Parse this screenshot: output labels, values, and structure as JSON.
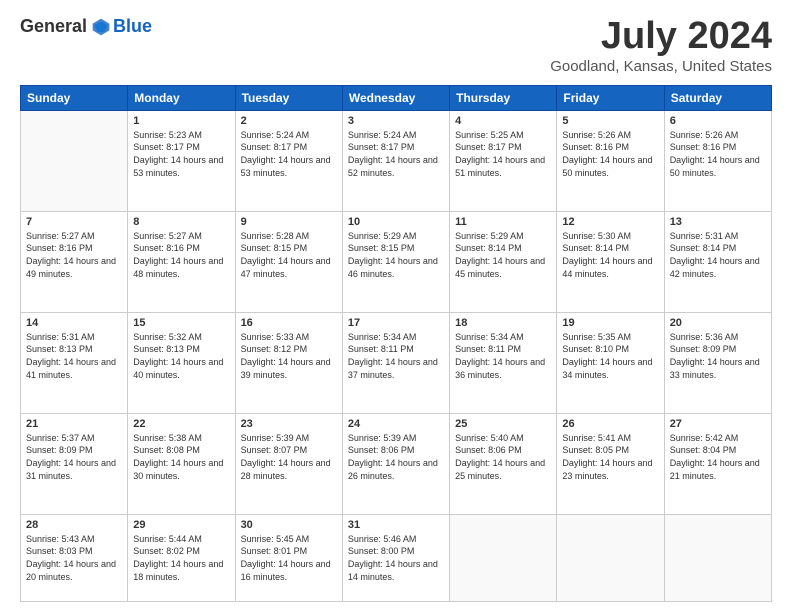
{
  "logo": {
    "general": "General",
    "blue": "Blue"
  },
  "title": "July 2024",
  "subtitle": "Goodland, Kansas, United States",
  "days_header": [
    "Sunday",
    "Monday",
    "Tuesday",
    "Wednesday",
    "Thursday",
    "Friday",
    "Saturday"
  ],
  "weeks": [
    [
      {
        "num": "",
        "sunrise": "",
        "sunset": "",
        "daylight": "",
        "empty": true
      },
      {
        "num": "1",
        "sunrise": "Sunrise: 5:23 AM",
        "sunset": "Sunset: 8:17 PM",
        "daylight": "Daylight: 14 hours and 53 minutes."
      },
      {
        "num": "2",
        "sunrise": "Sunrise: 5:24 AM",
        "sunset": "Sunset: 8:17 PM",
        "daylight": "Daylight: 14 hours and 53 minutes."
      },
      {
        "num": "3",
        "sunrise": "Sunrise: 5:24 AM",
        "sunset": "Sunset: 8:17 PM",
        "daylight": "Daylight: 14 hours and 52 minutes."
      },
      {
        "num": "4",
        "sunrise": "Sunrise: 5:25 AM",
        "sunset": "Sunset: 8:17 PM",
        "daylight": "Daylight: 14 hours and 51 minutes."
      },
      {
        "num": "5",
        "sunrise": "Sunrise: 5:26 AM",
        "sunset": "Sunset: 8:16 PM",
        "daylight": "Daylight: 14 hours and 50 minutes."
      },
      {
        "num": "6",
        "sunrise": "Sunrise: 5:26 AM",
        "sunset": "Sunset: 8:16 PM",
        "daylight": "Daylight: 14 hours and 50 minutes."
      }
    ],
    [
      {
        "num": "7",
        "sunrise": "Sunrise: 5:27 AM",
        "sunset": "Sunset: 8:16 PM",
        "daylight": "Daylight: 14 hours and 49 minutes."
      },
      {
        "num": "8",
        "sunrise": "Sunrise: 5:27 AM",
        "sunset": "Sunset: 8:16 PM",
        "daylight": "Daylight: 14 hours and 48 minutes."
      },
      {
        "num": "9",
        "sunrise": "Sunrise: 5:28 AM",
        "sunset": "Sunset: 8:15 PM",
        "daylight": "Daylight: 14 hours and 47 minutes."
      },
      {
        "num": "10",
        "sunrise": "Sunrise: 5:29 AM",
        "sunset": "Sunset: 8:15 PM",
        "daylight": "Daylight: 14 hours and 46 minutes."
      },
      {
        "num": "11",
        "sunrise": "Sunrise: 5:29 AM",
        "sunset": "Sunset: 8:14 PM",
        "daylight": "Daylight: 14 hours and 45 minutes."
      },
      {
        "num": "12",
        "sunrise": "Sunrise: 5:30 AM",
        "sunset": "Sunset: 8:14 PM",
        "daylight": "Daylight: 14 hours and 44 minutes."
      },
      {
        "num": "13",
        "sunrise": "Sunrise: 5:31 AM",
        "sunset": "Sunset: 8:14 PM",
        "daylight": "Daylight: 14 hours and 42 minutes."
      }
    ],
    [
      {
        "num": "14",
        "sunrise": "Sunrise: 5:31 AM",
        "sunset": "Sunset: 8:13 PM",
        "daylight": "Daylight: 14 hours and 41 minutes."
      },
      {
        "num": "15",
        "sunrise": "Sunrise: 5:32 AM",
        "sunset": "Sunset: 8:13 PM",
        "daylight": "Daylight: 14 hours and 40 minutes."
      },
      {
        "num": "16",
        "sunrise": "Sunrise: 5:33 AM",
        "sunset": "Sunset: 8:12 PM",
        "daylight": "Daylight: 14 hours and 39 minutes."
      },
      {
        "num": "17",
        "sunrise": "Sunrise: 5:34 AM",
        "sunset": "Sunset: 8:11 PM",
        "daylight": "Daylight: 14 hours and 37 minutes."
      },
      {
        "num": "18",
        "sunrise": "Sunrise: 5:34 AM",
        "sunset": "Sunset: 8:11 PM",
        "daylight": "Daylight: 14 hours and 36 minutes."
      },
      {
        "num": "19",
        "sunrise": "Sunrise: 5:35 AM",
        "sunset": "Sunset: 8:10 PM",
        "daylight": "Daylight: 14 hours and 34 minutes."
      },
      {
        "num": "20",
        "sunrise": "Sunrise: 5:36 AM",
        "sunset": "Sunset: 8:09 PM",
        "daylight": "Daylight: 14 hours and 33 minutes."
      }
    ],
    [
      {
        "num": "21",
        "sunrise": "Sunrise: 5:37 AM",
        "sunset": "Sunset: 8:09 PM",
        "daylight": "Daylight: 14 hours and 31 minutes."
      },
      {
        "num": "22",
        "sunrise": "Sunrise: 5:38 AM",
        "sunset": "Sunset: 8:08 PM",
        "daylight": "Daylight: 14 hours and 30 minutes."
      },
      {
        "num": "23",
        "sunrise": "Sunrise: 5:39 AM",
        "sunset": "Sunset: 8:07 PM",
        "daylight": "Daylight: 14 hours and 28 minutes."
      },
      {
        "num": "24",
        "sunrise": "Sunrise: 5:39 AM",
        "sunset": "Sunset: 8:06 PM",
        "daylight": "Daylight: 14 hours and 26 minutes."
      },
      {
        "num": "25",
        "sunrise": "Sunrise: 5:40 AM",
        "sunset": "Sunset: 8:06 PM",
        "daylight": "Daylight: 14 hours and 25 minutes."
      },
      {
        "num": "26",
        "sunrise": "Sunrise: 5:41 AM",
        "sunset": "Sunset: 8:05 PM",
        "daylight": "Daylight: 14 hours and 23 minutes."
      },
      {
        "num": "27",
        "sunrise": "Sunrise: 5:42 AM",
        "sunset": "Sunset: 8:04 PM",
        "daylight": "Daylight: 14 hours and 21 minutes."
      }
    ],
    [
      {
        "num": "28",
        "sunrise": "Sunrise: 5:43 AM",
        "sunset": "Sunset: 8:03 PM",
        "daylight": "Daylight: 14 hours and 20 minutes."
      },
      {
        "num": "29",
        "sunrise": "Sunrise: 5:44 AM",
        "sunset": "Sunset: 8:02 PM",
        "daylight": "Daylight: 14 hours and 18 minutes."
      },
      {
        "num": "30",
        "sunrise": "Sunrise: 5:45 AM",
        "sunset": "Sunset: 8:01 PM",
        "daylight": "Daylight: 14 hours and 16 minutes."
      },
      {
        "num": "31",
        "sunrise": "Sunrise: 5:46 AM",
        "sunset": "Sunset: 8:00 PM",
        "daylight": "Daylight: 14 hours and 14 minutes."
      },
      {
        "num": "",
        "sunrise": "",
        "sunset": "",
        "daylight": "",
        "empty": true
      },
      {
        "num": "",
        "sunrise": "",
        "sunset": "",
        "daylight": "",
        "empty": true
      },
      {
        "num": "",
        "sunrise": "",
        "sunset": "",
        "daylight": "",
        "empty": true
      }
    ]
  ]
}
